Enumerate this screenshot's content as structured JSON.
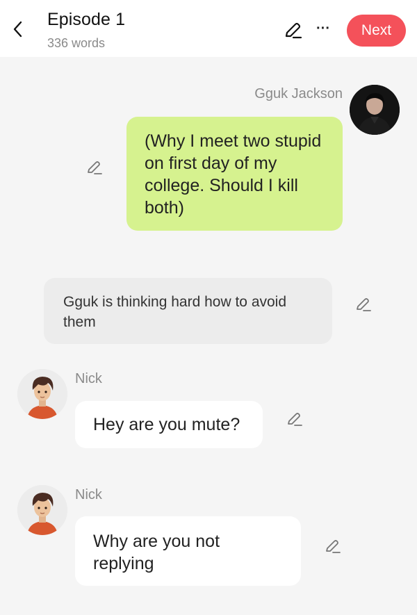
{
  "header": {
    "title": "Episode 1",
    "word_count": "336 words",
    "next_label": "Next",
    "more_label": "···"
  },
  "colors": {
    "accent": "#f4515a",
    "self_bubble": "#d6f28f",
    "narration_bubble": "#ececec",
    "other_bubble": "#ffffff",
    "background": "#f5f5f5"
  },
  "messages": [
    {
      "type": "self",
      "speaker": "Gguk Jackson",
      "text": "(Why I meet two stupid on first day of my college. Should I kill both)"
    },
    {
      "type": "narration",
      "text": "Gguk is thinking hard how to avoid them"
    },
    {
      "type": "other",
      "speaker": "Nick",
      "text": "Hey are you mute?"
    },
    {
      "type": "other",
      "speaker": "Nick",
      "text": "Why are you not replying"
    }
  ]
}
